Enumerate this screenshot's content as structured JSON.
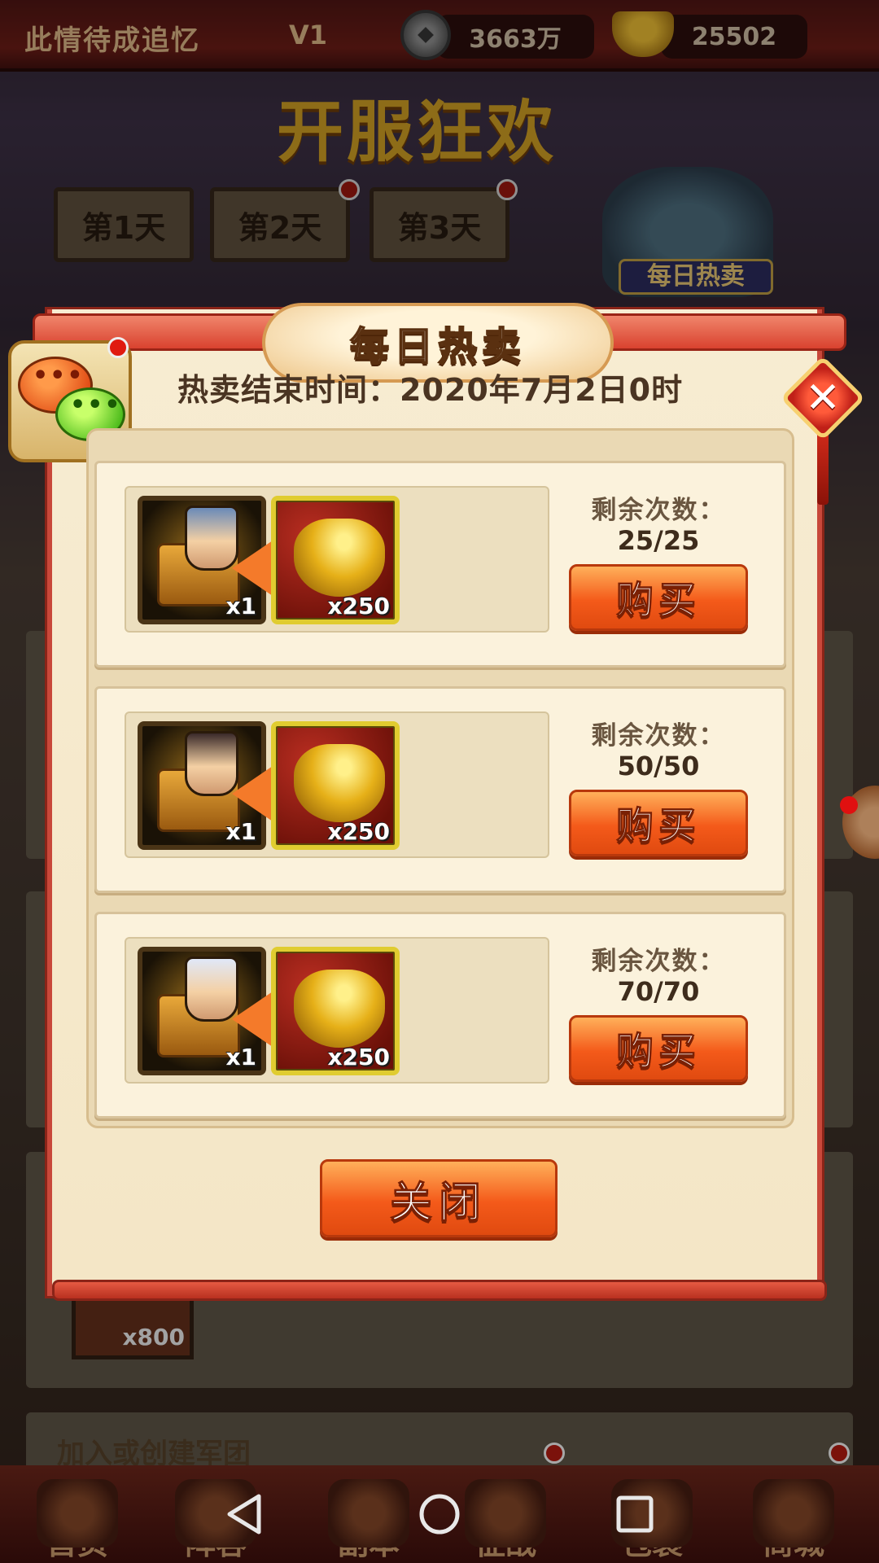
{
  "header": {
    "player_name": "此情待成追忆",
    "vip_level": "V1",
    "coins": "3663万",
    "gold": "25502"
  },
  "event": {
    "title": "开服狂欢",
    "days": [
      "第1天",
      "第2天",
      "第3天"
    ],
    "hot_sale_label": "每日热卖"
  },
  "background": {
    "reward_qty": "x800",
    "guild_banner": "加入或创建军团"
  },
  "modal": {
    "title": "每日热卖",
    "end_time": "热卖结束时间：2020年7月2日0时",
    "close_label": "关闭",
    "rows": [
      {
        "hero_qty": "x1",
        "cost_qty": "x250",
        "remain_label": "剩余次数：",
        "remain_value": "25/25",
        "buy_label": "购买"
      },
      {
        "hero_qty": "x1",
        "cost_qty": "x250",
        "remain_label": "剩余次数：",
        "remain_value": "50/50",
        "buy_label": "购买"
      },
      {
        "hero_qty": "x1",
        "cost_qty": "x250",
        "remain_label": "剩余次数：",
        "remain_value": "70/70",
        "buy_label": "购买"
      }
    ]
  },
  "bottom_nav": [
    {
      "label": "首页"
    },
    {
      "label": "阵容"
    },
    {
      "label": "副本"
    },
    {
      "label": "征战"
    },
    {
      "label": "包裹"
    },
    {
      "label": "商城"
    }
  ]
}
